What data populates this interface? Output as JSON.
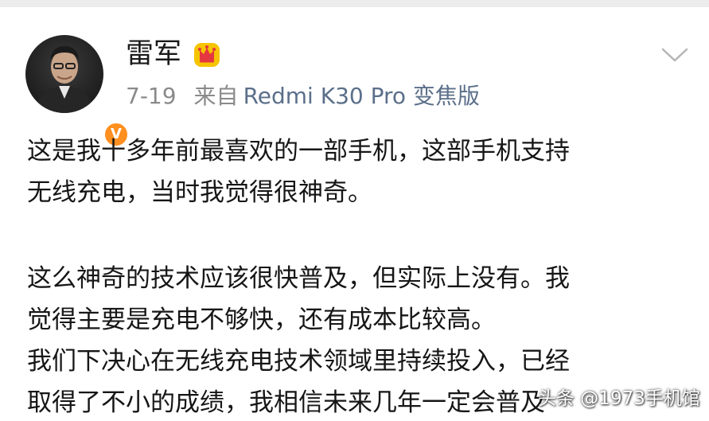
{
  "user": {
    "name": "雷军",
    "verified_badge": "V",
    "crown_icon": "crown-icon"
  },
  "meta": {
    "date": "7-19",
    "source_prefix": "来自",
    "device": "Redmi K30 Pro 变焦版"
  },
  "header": {
    "chevron_icon": "chevron-down-icon"
  },
  "post": {
    "paragraph1": [
      "这是我十多年前最喜欢的一部手机，这部手机支持",
      "无线充电，当时我觉得很神奇。"
    ],
    "paragraph2": [
      "这么神奇的技术应该很快普及，但实际上没有。我",
      "觉得主要是充电不够快，还有成本比较高。",
      "我们下决心在无线充电技术领域里持续投入，已经",
      "取得了不小的成绩，我相信未来几年一定会普及"
    ]
  },
  "watermark": "头条 @1973手机馆",
  "colors": {
    "meta_gray": "#8a8a8a",
    "device_blue": "#5b6f8a",
    "badge_orange": "#ff8f1f",
    "crown_gold": "#f2b200"
  }
}
